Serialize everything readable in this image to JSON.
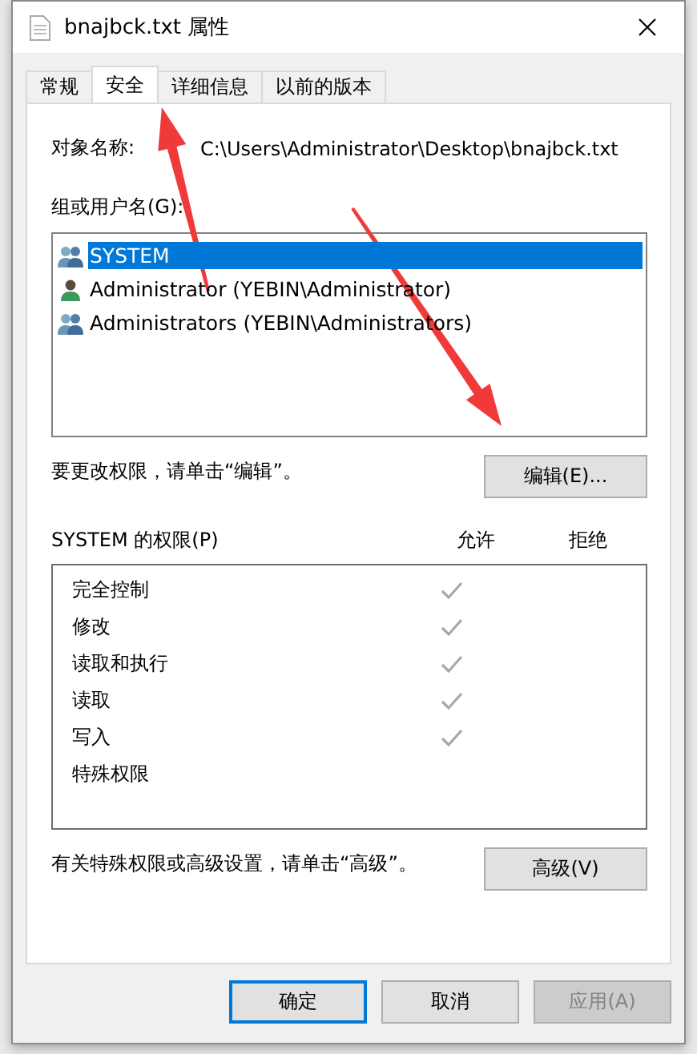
{
  "window": {
    "title": "bnajbck.txt 属性"
  },
  "tabs": [
    {
      "label": "常规",
      "selected": false
    },
    {
      "label": "安全",
      "selected": true
    },
    {
      "label": "详细信息",
      "selected": false
    },
    {
      "label": "以前的版本",
      "selected": false
    }
  ],
  "object_name": {
    "label": "对象名称:",
    "value": "C:\\Users\\Administrator\\Desktop\\bnajbck.txt"
  },
  "groups": {
    "label": "组或用户名(G):",
    "items": [
      {
        "name": "SYSTEM",
        "kind": "group",
        "selected": true
      },
      {
        "name": "Administrator (YEBIN\\Administrator)",
        "kind": "user",
        "selected": false
      },
      {
        "name": "Administrators (YEBIN\\Administrators)",
        "kind": "group",
        "selected": false
      }
    ]
  },
  "edit_hint": "要更改权限，请单击“编辑”。",
  "edit_button": "编辑(E)...",
  "permissions": {
    "label": "SYSTEM 的权限(P)",
    "allow_header": "允许",
    "deny_header": "拒绝",
    "rows": [
      {
        "name": "完全控制",
        "allow": true
      },
      {
        "name": "修改",
        "allow": true
      },
      {
        "name": "读取和执行",
        "allow": true
      },
      {
        "name": "读取",
        "allow": true
      },
      {
        "name": "写入",
        "allow": true
      },
      {
        "name": "特殊权限",
        "allow": false
      }
    ]
  },
  "advanced_hint": "有关特殊权限或高级设置，请单击“高级”。",
  "advanced_button": "高级(V)",
  "buttons": [
    {
      "label": "确定",
      "kind": "default",
      "disabled": false
    },
    {
      "label": "取消",
      "kind": "normal",
      "disabled": false
    },
    {
      "label": "应用(A)",
      "kind": "normal",
      "disabled": true
    }
  ],
  "annotations": [
    {
      "kind": "arrow"
    },
    {
      "kind": "arrow"
    }
  ]
}
